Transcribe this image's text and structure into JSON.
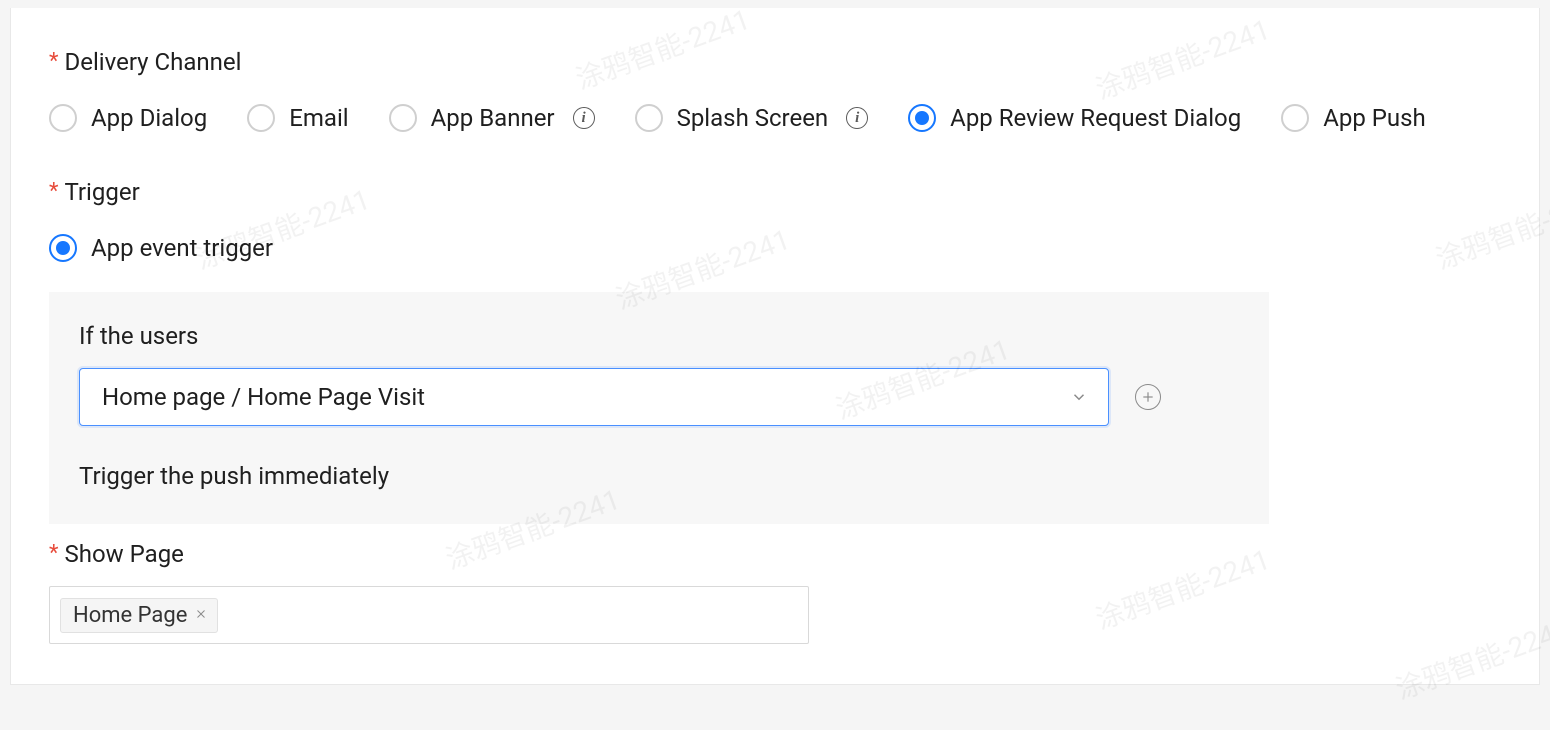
{
  "delivery_channel": {
    "label": "Delivery Channel",
    "options": [
      {
        "label": "App Dialog",
        "checked": false,
        "info": false
      },
      {
        "label": "Email",
        "checked": false,
        "info": false
      },
      {
        "label": "App Banner",
        "checked": false,
        "info": true
      },
      {
        "label": "Splash Screen",
        "checked": false,
        "info": true
      },
      {
        "label": "App Review Request Dialog",
        "checked": true,
        "info": false
      },
      {
        "label": "App Push",
        "checked": false,
        "info": false
      }
    ]
  },
  "trigger": {
    "label": "Trigger",
    "options": [
      {
        "label": "App event trigger",
        "checked": true
      }
    ],
    "box": {
      "sublabel": "If the users",
      "select_value": "Home page / Home Page Visit",
      "note": "Trigger the push immediately"
    }
  },
  "show_page": {
    "label": "Show Page",
    "tags": [
      "Home Page"
    ]
  },
  "watermark_text": "涂鸦智能-2241"
}
